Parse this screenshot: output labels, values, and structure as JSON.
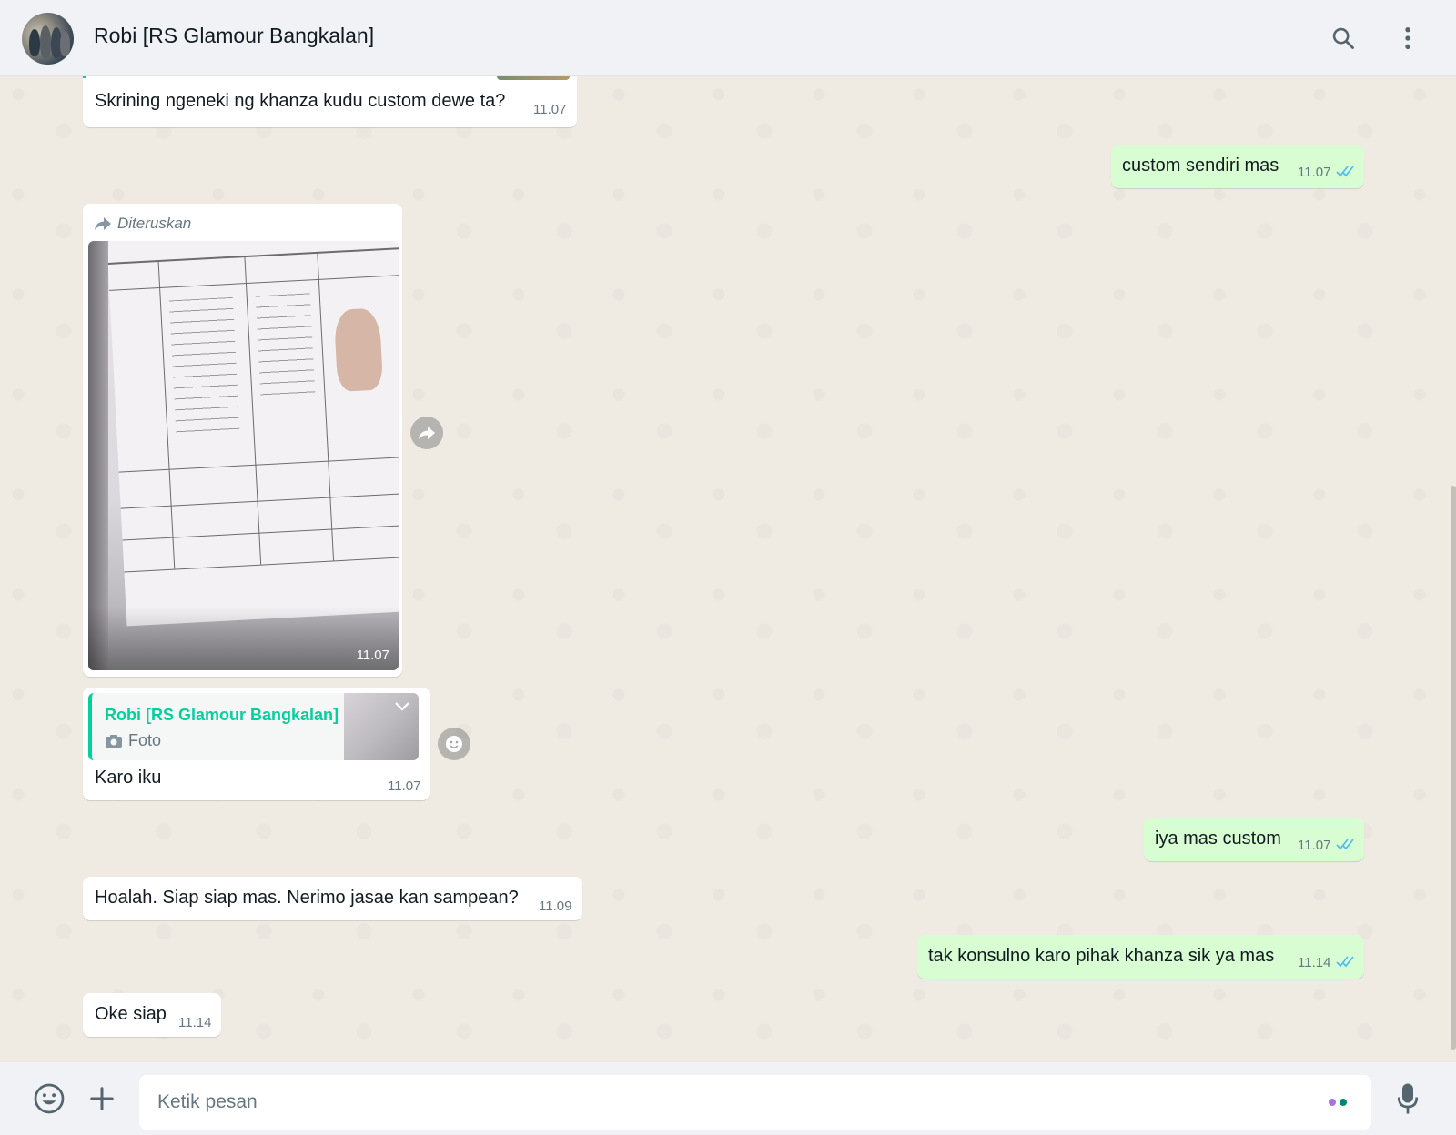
{
  "header": {
    "contact_name": "Robi [RS Glamour Bangkalan]",
    "search_icon": "search-icon",
    "menu_icon": "more-vertical-icon"
  },
  "messages": [
    {
      "id": "m1",
      "direction": "in",
      "text": "Skrining ngeneki ng khanza kudu custom dewe ta?",
      "time": "11.07"
    },
    {
      "id": "m2",
      "direction": "out",
      "text": "custom sendiri mas",
      "time": "11.07",
      "status": "read"
    },
    {
      "id": "m3",
      "direction": "in",
      "type": "image",
      "forwarded_label": "Diteruskan",
      "time": "11.07",
      "image_alt": "photo"
    },
    {
      "id": "m4",
      "direction": "in",
      "type": "reply",
      "reply_to_name": "Robi [RS Glamour Bangkalan]",
      "reply_to_type": "Foto",
      "text": "Karo iku",
      "time": "11.07"
    },
    {
      "id": "m5",
      "direction": "out",
      "text": "iya mas custom",
      "time": "11.07",
      "status": "read"
    },
    {
      "id": "m6",
      "direction": "in",
      "text": "Hoalah. Siap siap mas. Nerimo jasae kan sampean?",
      "time": "11.09"
    },
    {
      "id": "m7",
      "direction": "out",
      "text": "tak konsulno karo pihak khanza sik ya mas",
      "time": "11.14",
      "status": "read"
    },
    {
      "id": "m8",
      "direction": "in",
      "text": "Oke siap",
      "time": "11.14"
    }
  ],
  "composer": {
    "placeholder": "Ketik pesan",
    "value": "",
    "emoji_icon": "emoji-icon",
    "attach_icon": "plus-icon",
    "mic_icon": "microphone-icon"
  },
  "colors": {
    "header_bg": "#f0f2f5",
    "chat_bg": "#efeae2",
    "bubble_in": "#ffffff",
    "bubble_out": "#d9fdd3",
    "accent": "#06cf9c",
    "read_tick": "#53bdeb"
  }
}
